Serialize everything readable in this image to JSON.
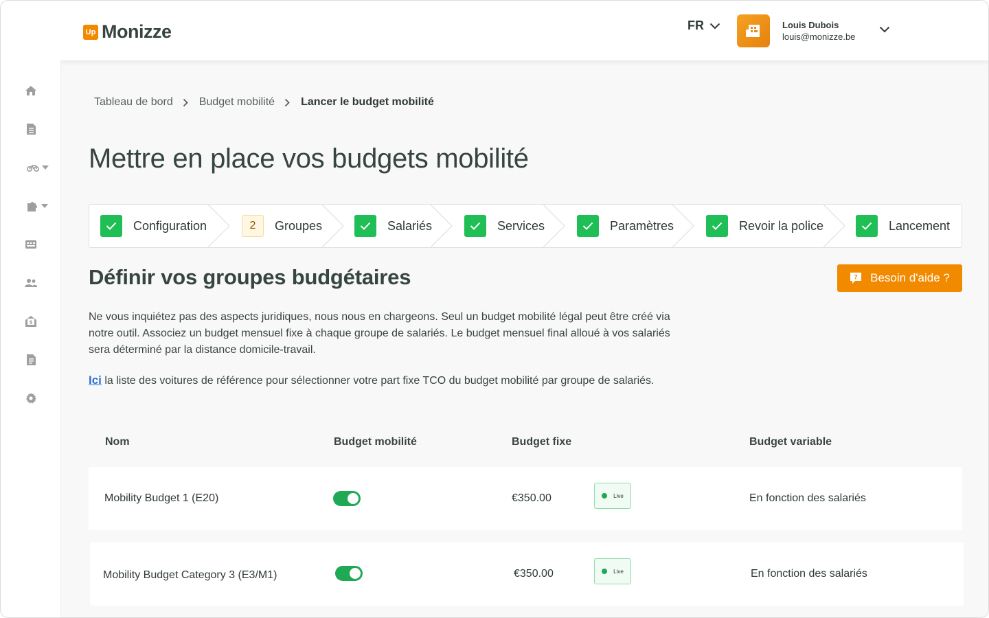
{
  "header": {
    "logo_badge": "Up",
    "logo_text": "Monizze",
    "language": "FR",
    "user_name": "Louis Dubois",
    "user_email": "louis@monizze.be"
  },
  "sidebar": {
    "items": [
      "home-icon",
      "document-icon",
      "bike-icon",
      "puzzle-icon",
      "card-icon",
      "users-icon",
      "money-envelope-icon",
      "report-icon",
      "settings-icon"
    ]
  },
  "breadcrumb": {
    "items": [
      "Tableau de bord",
      "Budget mobilité",
      "Lancer le budget mobilité"
    ]
  },
  "page_title": "Mettre en place vos budgets mobilité",
  "stepper": {
    "steps": [
      {
        "label": "Configuration",
        "state": "done"
      },
      {
        "label": "Groupes",
        "state": "current",
        "number": "2"
      },
      {
        "label": "Salariés",
        "state": "done"
      },
      {
        "label": "Services",
        "state": "done"
      },
      {
        "label": "Paramètres",
        "state": "done"
      },
      {
        "label": "Revoir la police",
        "state": "done"
      },
      {
        "label": "Lancement",
        "state": "done"
      }
    ]
  },
  "section_title": "Définir vos groupes budgétaires",
  "help_button": "Besoin d'aide ?",
  "intro_text": "Ne vous inquiétez pas des aspects juridiques, nous nous en chargeons. Seul un budget mobilité légal peut être créé via notre outil. Associez un budget mensuel fixe à chaque groupe de salariés. Le budget mensuel final alloué à vos salariés sera déterminé par la distance domicile-travail.",
  "link_text": "Ici",
  "link_sentence": " la liste des voitures de référence pour sélectionner votre part fixe TCO du budget mobilité par groupe de salariés.",
  "table": {
    "headers": [
      "Nom",
      "Budget mobilité",
      "Budget fixe",
      "Budget variable"
    ],
    "rows": [
      {
        "name": "Mobility Budget 1 (E20)",
        "enabled": true,
        "fixed": "€350.00",
        "status": "Live",
        "variable": "En fonction des salariés"
      },
      {
        "name": "Mobility Budget Category 3 (E3/M1)",
        "enabled": true,
        "fixed": "€350.00",
        "status": "Live",
        "variable": "En fonction des salariés"
      }
    ]
  },
  "colors": {
    "accent": "#f28a00",
    "success": "#1fbf55",
    "toggle_on": "#1fa955",
    "link": "#2d6fd6"
  }
}
